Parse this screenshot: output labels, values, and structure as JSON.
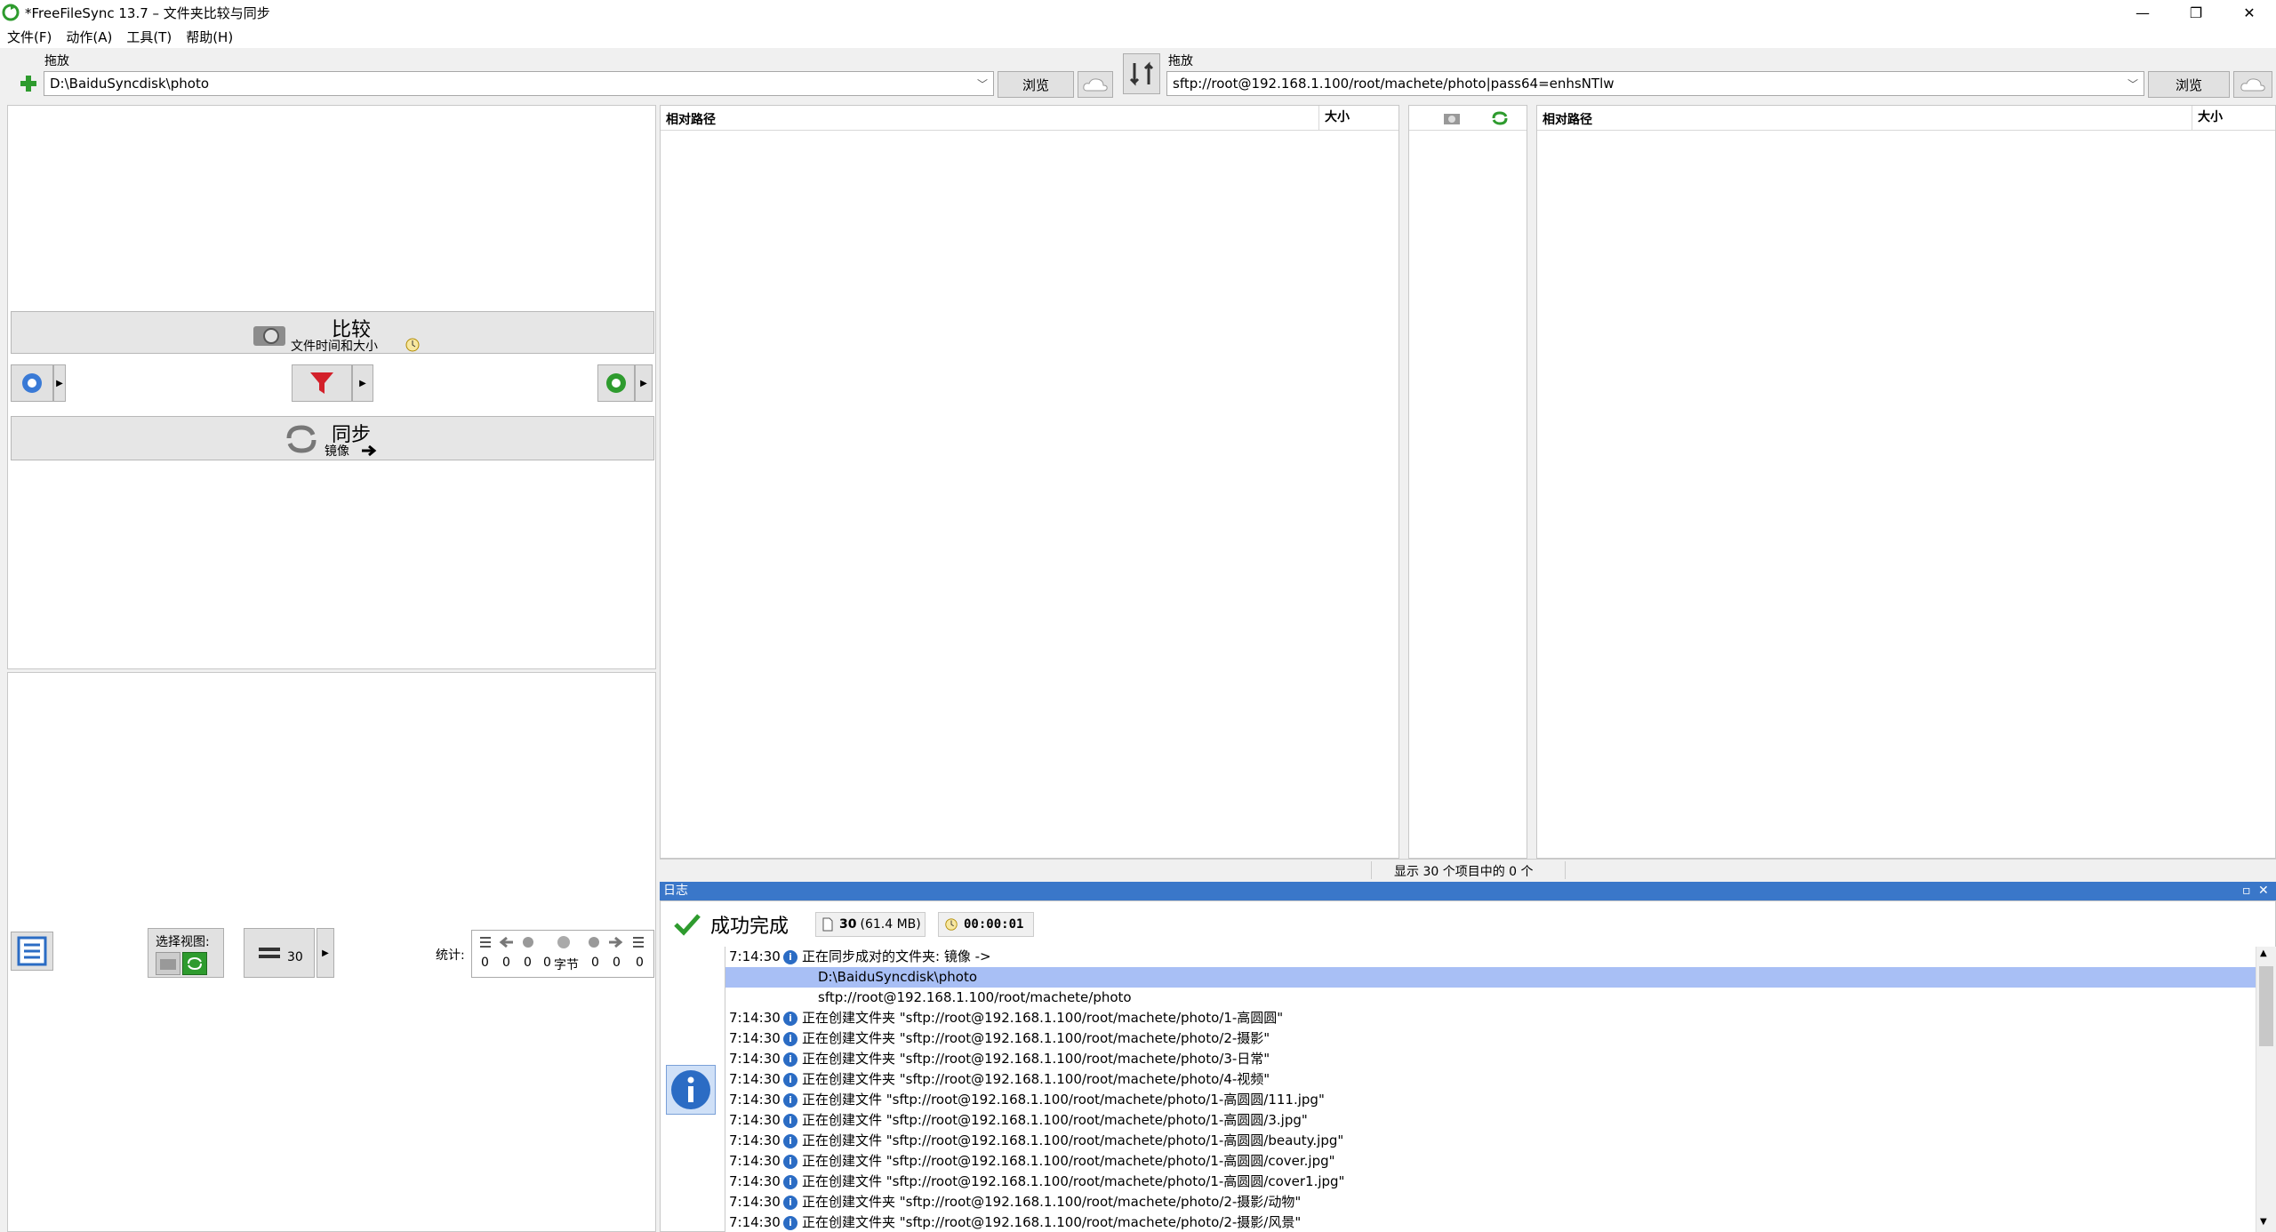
{
  "window": {
    "title": "*FreeFileSync 13.7 – 文件夹比较与同步",
    "controls": {
      "minimize": "—",
      "restore": "❐",
      "close": "✕"
    }
  },
  "menu": [
    "文件(F)",
    "动作(A)",
    "工具(T)",
    "帮助(H)"
  ],
  "left_folder": {
    "drag_label": "拖放",
    "path": "D:\\BaiduSyncdisk\\photo",
    "browse": "浏览"
  },
  "right_folder": {
    "drag_label": "拖放",
    "path": "sftp://root@192.168.1.100/root/machete/photo|pass64=enhsNTlw",
    "browse": "浏览"
  },
  "compare": {
    "label": "比较",
    "sub": "文件时间和大小"
  },
  "sync": {
    "label": "同步",
    "sub": "镜像"
  },
  "grid": {
    "left_col_path": "相对路径",
    "left_col_size": "大小",
    "right_col_path": "相对路径",
    "right_col_size": "大小",
    "status": "显示 30 个项目中的 0 个"
  },
  "bottom": {
    "select_view_label": "选择视图:",
    "equal_count": "30",
    "stats_label": "统计:",
    "stats_values": [
      "0",
      "0",
      "0",
      "0",
      "字节",
      "0",
      "0",
      "0"
    ]
  },
  "log": {
    "title": "日志",
    "result": "成功完成",
    "items_count": "30",
    "items_size": "(61.4 MB)",
    "elapsed": "00:00:01",
    "lines": [
      {
        "time": "7:14:30",
        "msg": "正在同步成对的文件夹: 镜像 ->",
        "icon": true
      },
      {
        "time": "",
        "msg": "D:\\BaiduSyncdisk\\photo",
        "icon": false
      },
      {
        "time": "",
        "msg": "sftp://root@192.168.1.100/root/machete/photo",
        "icon": false
      },
      {
        "time": "7:14:30",
        "msg": "正在创建文件夹 \"sftp://root@192.168.1.100/root/machete/photo/1-高圆圆\"",
        "icon": true
      },
      {
        "time": "7:14:30",
        "msg": "正在创建文件夹 \"sftp://root@192.168.1.100/root/machete/photo/2-摄影\"",
        "icon": true
      },
      {
        "time": "7:14:30",
        "msg": "正在创建文件夹 \"sftp://root@192.168.1.100/root/machete/photo/3-日常\"",
        "icon": true
      },
      {
        "time": "7:14:30",
        "msg": "正在创建文件夹 \"sftp://root@192.168.1.100/root/machete/photo/4-视频\"",
        "icon": true
      },
      {
        "time": "7:14:30",
        "msg": "正在创建文件 \"sftp://root@192.168.1.100/root/machete/photo/1-高圆圆/111.jpg\"",
        "icon": true
      },
      {
        "time": "7:14:30",
        "msg": "正在创建文件 \"sftp://root@192.168.1.100/root/machete/photo/1-高圆圆/3.jpg\"",
        "icon": true
      },
      {
        "time": "7:14:30",
        "msg": "正在创建文件 \"sftp://root@192.168.1.100/root/machete/photo/1-高圆圆/beauty.jpg\"",
        "icon": true
      },
      {
        "time": "7:14:30",
        "msg": "正在创建文件 \"sftp://root@192.168.1.100/root/machete/photo/1-高圆圆/cover.jpg\"",
        "icon": true
      },
      {
        "time": "7:14:30",
        "msg": "正在创建文件 \"sftp://root@192.168.1.100/root/machete/photo/1-高圆圆/cover1.jpg\"",
        "icon": true
      },
      {
        "time": "7:14:30",
        "msg": "正在创建文件夹 \"sftp://root@192.168.1.100/root/machete/photo/2-摄影/动物\"",
        "icon": true
      },
      {
        "time": "7:14:30",
        "msg": "正在创建文件夹 \"sftp://root@192.168.1.100/root/machete/photo/2-摄影/风景\"",
        "icon": true
      }
    ]
  },
  "colors": {
    "accent": "#3a77c9",
    "selected_row": "#a8bff5",
    "success": "#2e9b2e",
    "filter": "#d3202a"
  }
}
